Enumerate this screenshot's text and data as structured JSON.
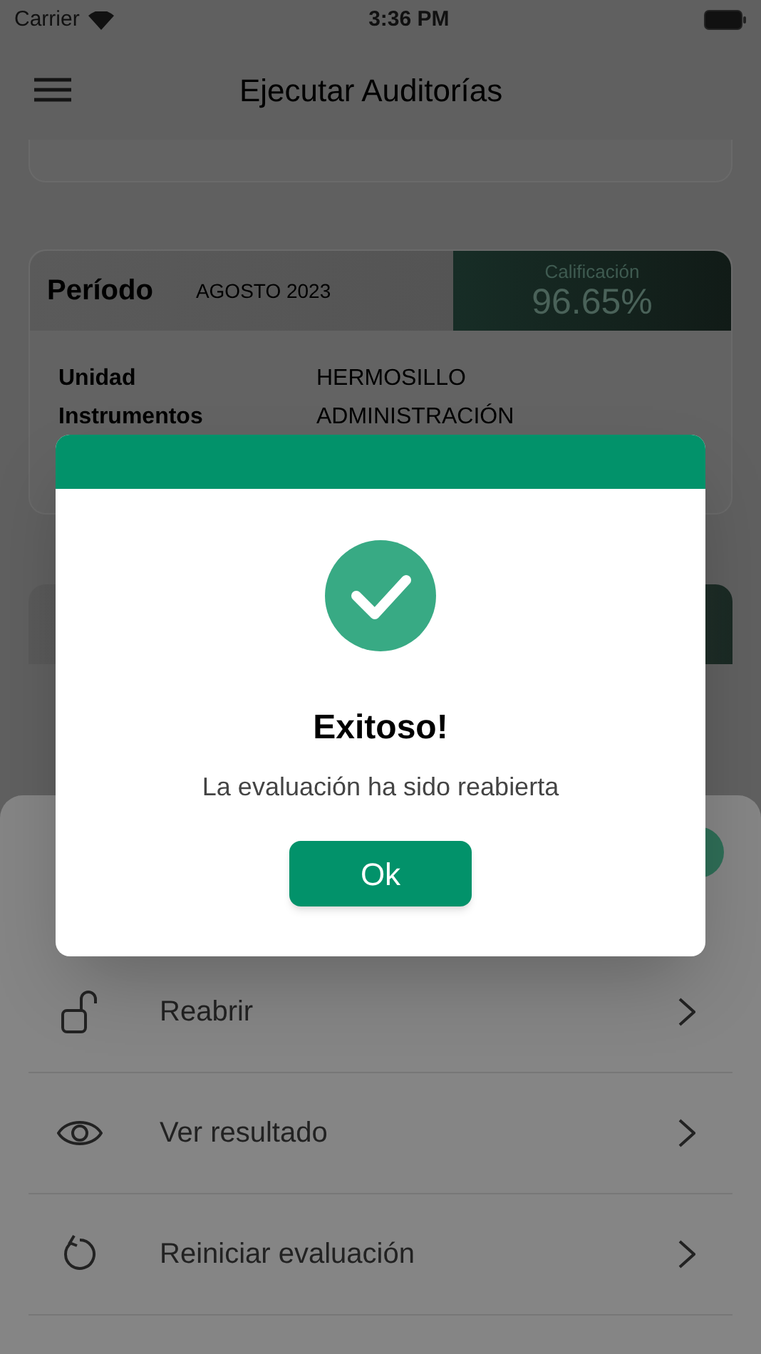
{
  "status_bar": {
    "carrier": "Carrier",
    "time": "3:36 PM"
  },
  "header": {
    "title": "Ejecutar Auditorías"
  },
  "summary": {
    "period_label": "Período",
    "period_value": "AGOSTO 2023",
    "score_label": "Calificación",
    "score_value": "96.65%",
    "fields": [
      {
        "label": "Unidad",
        "value": "HERMOSILLO"
      },
      {
        "label": "Instrumentos",
        "value": "ADMINISTRACIÓN"
      }
    ]
  },
  "action_sheet": {
    "items": [
      {
        "label": "Reabrir",
        "kind": "unlock"
      },
      {
        "label": "Ver resultado",
        "kind": "eye"
      },
      {
        "label": "Reiniciar evaluación",
        "kind": "reset"
      }
    ]
  },
  "dialog": {
    "title": "Exitoso!",
    "message": "La evaluación ha sido reabierta",
    "button": "Ok"
  }
}
